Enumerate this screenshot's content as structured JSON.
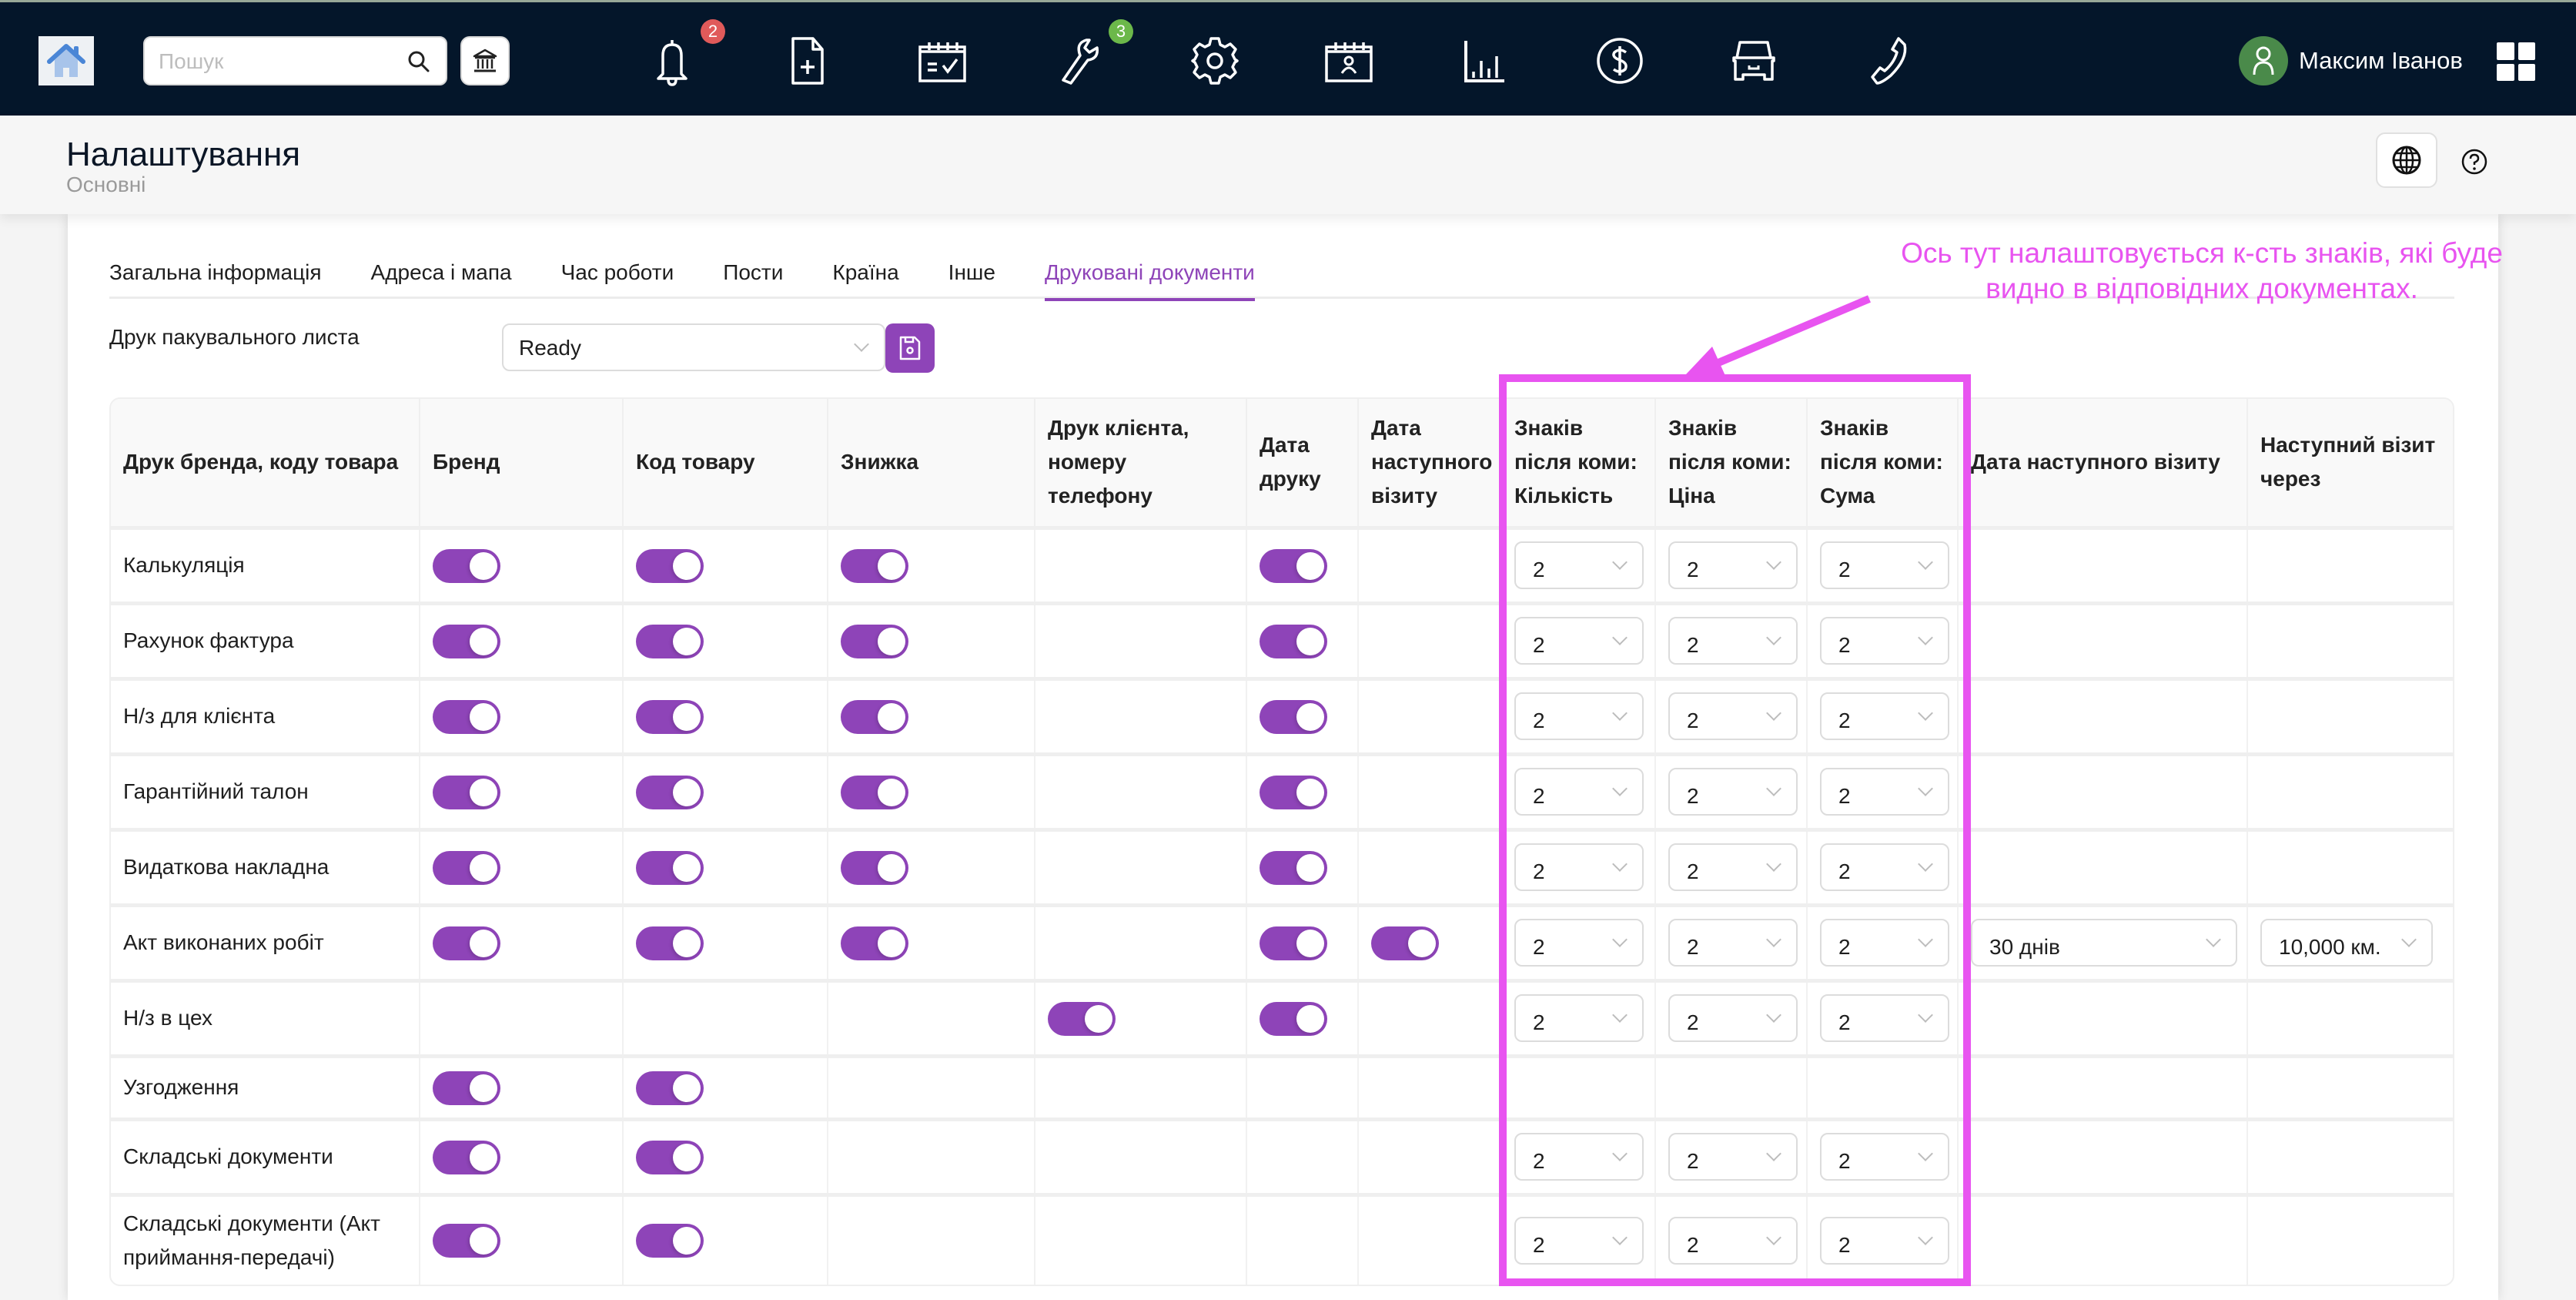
{
  "topbar": {
    "search_placeholder": "Пошук",
    "nav_icons": [
      {
        "name": "bell-icon",
        "badge": "2",
        "badge_color": "#e05a5a"
      },
      {
        "name": "new-document-icon",
        "badge": null
      },
      {
        "name": "calendar-check-icon",
        "badge": null
      },
      {
        "name": "wrench-icon",
        "badge": "3",
        "badge_color": "#6cb84a"
      },
      {
        "name": "gear-icon",
        "badge": null
      },
      {
        "name": "calendar-contact-icon",
        "badge": null
      },
      {
        "name": "bar-chart-icon",
        "badge": null
      },
      {
        "name": "dollar-icon",
        "badge": null
      },
      {
        "name": "car-icon",
        "badge": null
      },
      {
        "name": "phone-icon",
        "badge": null
      }
    ],
    "badges": {
      "notifications": "2",
      "repairs": "3"
    },
    "user_name": "Максим Іванов"
  },
  "page": {
    "title": "Налаштування",
    "subtitle": "Основні"
  },
  "tabs": [
    {
      "label": "Загальна інформація",
      "active": false
    },
    {
      "label": "Адреса і мапа",
      "active": false
    },
    {
      "label": "Час роботи",
      "active": false
    },
    {
      "label": "Пости",
      "active": false
    },
    {
      "label": "Країна",
      "active": false
    },
    {
      "label": "Інше",
      "active": false
    },
    {
      "label": "Друковані документи",
      "active": true
    }
  ],
  "packing": {
    "label": "Друк пакувального листа",
    "value": "Ready"
  },
  "table": {
    "headers": [
      "Друк бренда, коду товара",
      "Бренд",
      "Код товару",
      "Знижка",
      "Друк клієнта, номеру телефону",
      "Дата друку",
      "Дата наступного візиту",
      "Знаків після коми: Кількість",
      "Знаків після коми: Ціна",
      "Знаків після коми: Сума",
      "Дата наступного візиту",
      "Наступний візит через"
    ],
    "rows": [
      {
        "name": "Калькуляція",
        "brand": true,
        "code": true,
        "discount": true,
        "client": false,
        "print_date": true,
        "next_visit_toggle": false,
        "qty": "2",
        "price": "2",
        "sum": "2",
        "next_visit_date": null,
        "next_visit_after": null
      },
      {
        "name": "Рахунок фактура",
        "brand": true,
        "code": true,
        "discount": true,
        "client": false,
        "print_date": true,
        "next_visit_toggle": false,
        "qty": "2",
        "price": "2",
        "sum": "2",
        "next_visit_date": null,
        "next_visit_after": null
      },
      {
        "name": "Н/з для клієнта",
        "brand": true,
        "code": true,
        "discount": true,
        "client": false,
        "print_date": true,
        "next_visit_toggle": false,
        "qty": "2",
        "price": "2",
        "sum": "2",
        "next_visit_date": null,
        "next_visit_after": null
      },
      {
        "name": "Гарантійний талон",
        "brand": true,
        "code": true,
        "discount": true,
        "client": false,
        "print_date": true,
        "next_visit_toggle": false,
        "qty": "2",
        "price": "2",
        "sum": "2",
        "next_visit_date": null,
        "next_visit_after": null
      },
      {
        "name": "Видаткова накладна",
        "brand": true,
        "code": true,
        "discount": true,
        "client": false,
        "print_date": true,
        "next_visit_toggle": false,
        "qty": "2",
        "price": "2",
        "sum": "2",
        "next_visit_date": null,
        "next_visit_after": null
      },
      {
        "name": "Акт виконаних робіт",
        "brand": true,
        "code": true,
        "discount": true,
        "client": false,
        "print_date": true,
        "next_visit_toggle": true,
        "qty": "2",
        "price": "2",
        "sum": "2",
        "next_visit_date": "30 днів",
        "next_visit_after": "10,000 км."
      },
      {
        "name": "Н/з в цех",
        "brand": false,
        "code": false,
        "discount": false,
        "client": true,
        "print_date": true,
        "next_visit_toggle": false,
        "qty": "2",
        "price": "2",
        "sum": "2",
        "next_visit_date": null,
        "next_visit_after": null
      },
      {
        "name": "Узгодження",
        "brand": true,
        "code": true,
        "discount": false,
        "client": false,
        "print_date": false,
        "next_visit_toggle": false,
        "qty": null,
        "price": null,
        "sum": null,
        "next_visit_date": null,
        "next_visit_after": null
      },
      {
        "name": "Складські документи",
        "brand": true,
        "code": true,
        "discount": false,
        "client": false,
        "print_date": false,
        "next_visit_toggle": false,
        "qty": "2",
        "price": "2",
        "sum": "2",
        "next_visit_date": null,
        "next_visit_after": null
      },
      {
        "name": "Складські документи (Акт приймання-передачі)",
        "brand": true,
        "code": true,
        "discount": false,
        "client": false,
        "print_date": false,
        "next_visit_toggle": false,
        "qty": "2",
        "price": "2",
        "sum": "2",
        "next_visit_date": null,
        "next_visit_after": null
      }
    ]
  },
  "annotation": {
    "text": "Ось тут налаштовується к-сть знаків, які буде видно в відповідних документах.",
    "color": "#e854f0"
  },
  "colors": {
    "accent": "#8e44b8",
    "topbar": "#04162a"
  }
}
